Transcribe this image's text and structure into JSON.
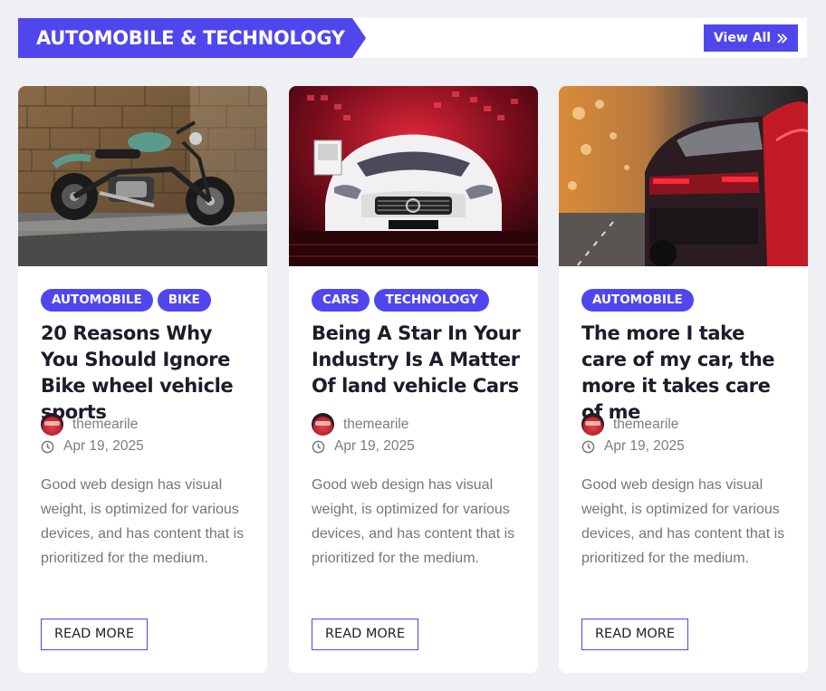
{
  "section": {
    "title": "AUTOMOBILE & TECHNOLOGY",
    "view_all_label": "View All"
  },
  "colors": {
    "accent": "#5046ee",
    "background": "#eef0f3",
    "title_text": "#1c1c2a",
    "meta_text": "#7d7d7d"
  },
  "posts": [
    {
      "image": "motorcycle-photo",
      "tags": [
        "AUTOMOBILE",
        "BIKE"
      ],
      "title": "20 Reasons Why You Should Ignore Bike wheel vehicle sports",
      "author": "themearile",
      "date": "Apr 19, 2025",
      "excerpt": "Good web design has visual weight, is optimized for various devices, and has content that is prioritized for the medium.",
      "read_more": "READ MORE"
    },
    {
      "image": "white-sports-car-photo",
      "tags": [
        "CARS",
        "TECHNOLOGY"
      ],
      "title": "Being A Star In Your Industry Is A Matter Of land vehicle Cars",
      "author": "themearile",
      "date": "Apr 19, 2025",
      "excerpt": "Good web design has visual weight, is optimized for various devices, and has content that is prioritized for the medium.",
      "read_more": "READ MORE"
    },
    {
      "image": "red-car-taillight-photo",
      "tags": [
        "AUTOMOBILE"
      ],
      "title": "The more I take care of my car, the more it takes care of me",
      "author": "themearile",
      "date": "Apr 19, 2025",
      "excerpt": "Good web design has visual weight, is optimized for various devices, and has content that is prioritized for the medium.",
      "read_more": "READ MORE"
    }
  ]
}
